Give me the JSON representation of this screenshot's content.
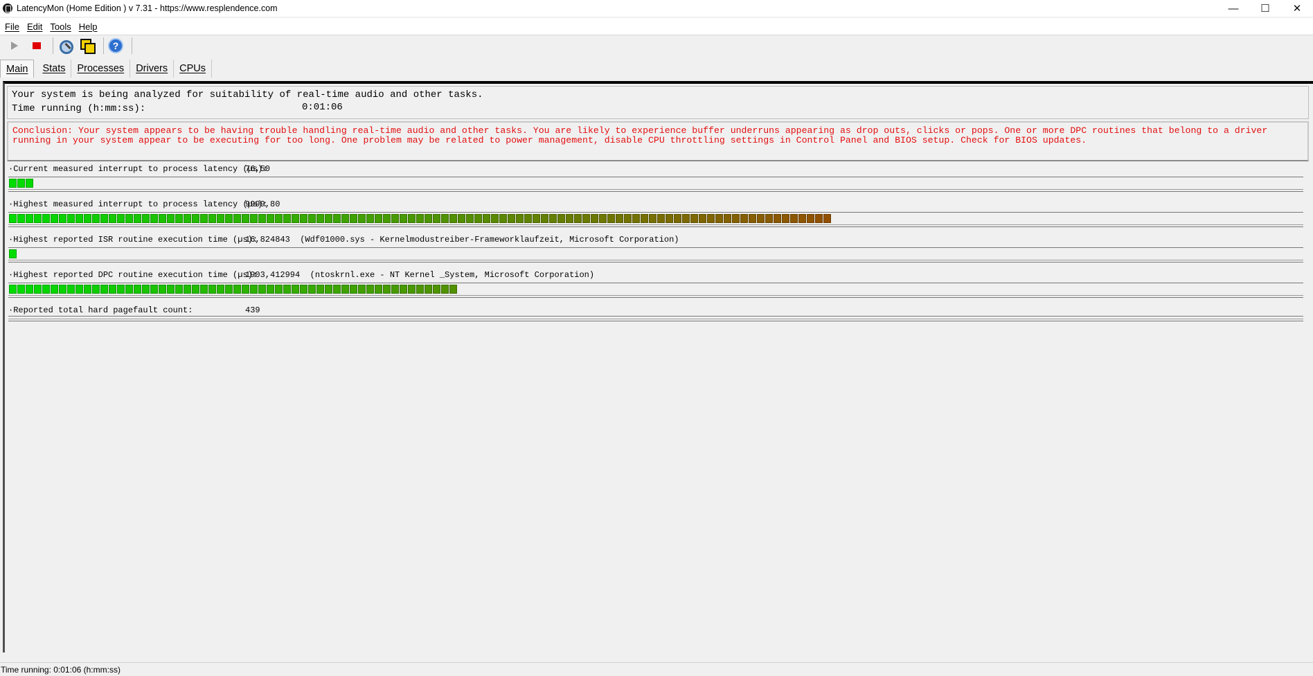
{
  "window": {
    "title": "LatencyMon  (Home Edition )  v 7.31 - https://www.resplendence.com",
    "controls": {
      "minimize": "—",
      "maximize": "☐",
      "close": "✕"
    }
  },
  "menu": [
    "File",
    "Edit",
    "Tools",
    "Help"
  ],
  "toolbar": {
    "buttons": [
      {
        "name": "play-icon",
        "label": "Start"
      },
      {
        "name": "stop-icon",
        "label": "Stop"
      },
      {
        "name": "gear-icon",
        "label": "Options"
      },
      {
        "name": "windows-icon",
        "label": "Windows"
      },
      {
        "name": "help-icon",
        "label": "?"
      }
    ]
  },
  "tabs": [
    "Main",
    "Stats",
    "Processes",
    "Drivers",
    "CPUs"
  ],
  "active_tab": "Main",
  "main": {
    "analysis_text": "Your system is being analyzed for suitability of real-time audio and other tasks.",
    "time_running_label": "Time running (h:mm:ss):",
    "time_running_value": "0:01:06",
    "conclusion_line1": "Conclusion: Your system appears to be having trouble handling real-time audio and other tasks. You are likely to experience buffer underruns appearing as drop outs, clicks or pops. One or more DPC routines that belong to a driver",
    "conclusion_line2": "running in your system appear to be executing for too long. One problem may be related to power management, disable CPU throttling settings in Control Panel and BIOS setup. Check for BIOS updates.",
    "metrics": [
      {
        "label": "·Current measured interrupt to process latency (µs):",
        "value": "76,50",
        "bar_fraction": 0.017
      },
      {
        "label": "·Highest measured interrupt to process latency (µs):",
        "value": "9999,80",
        "bar_fraction": 0.636
      },
      {
        "label": "·Highest reported ISR routine execution time (µs):",
        "value": "16,824843  (Wdf01000.sys - Kernelmodustreiber-Frameworklaufzeit, Microsoft Corporation)",
        "bar_fraction": 0.005
      },
      {
        "label": "·Highest reported DPC routine execution time (µs):",
        "value": "1903,412994  (ntoskrnl.exe - NT Kernel _System, Microsoft Corporation)",
        "bar_fraction": 0.349
      },
      {
        "label": "·Reported total hard pagefault count:",
        "value": "439",
        "bar_fraction": 0
      }
    ]
  },
  "statusbar": {
    "text": "Time running: 0:01:06  (h:mm:ss)"
  },
  "colors": {
    "conclusion": "#e30f10",
    "bar_start": "#00dd00",
    "bar_end": "#cc0000"
  }
}
